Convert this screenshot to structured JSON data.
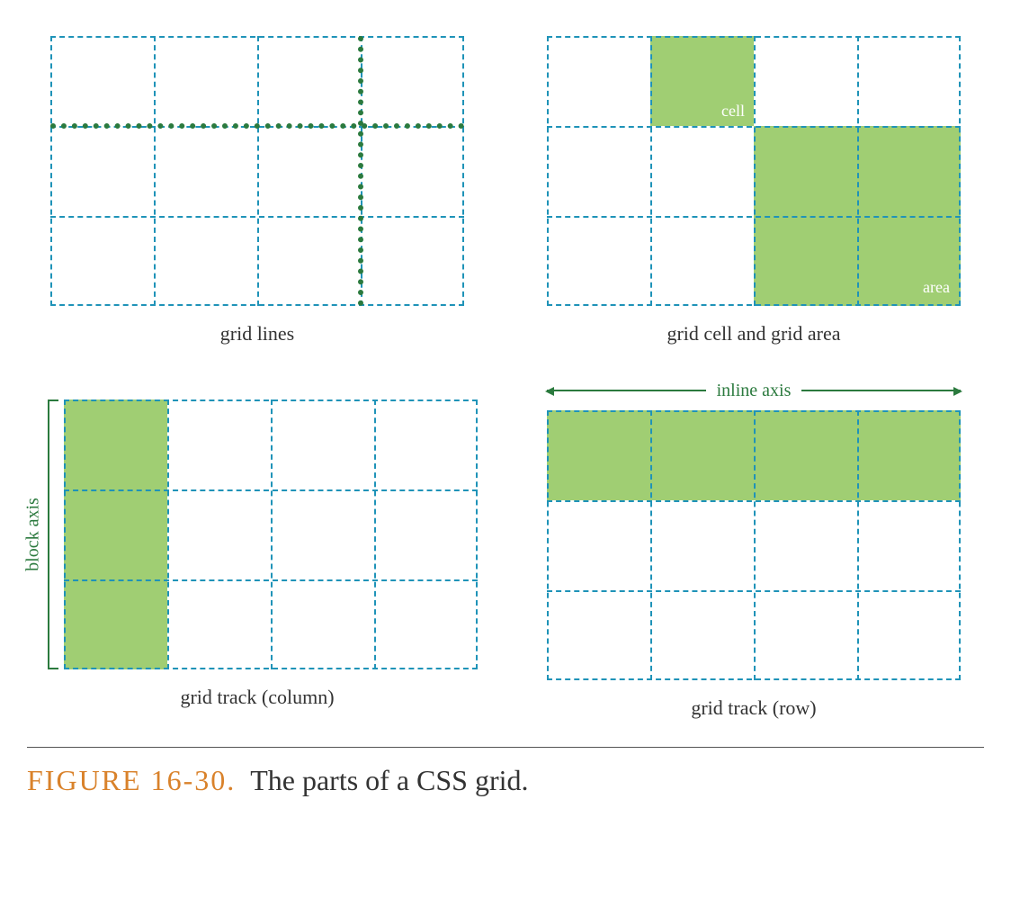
{
  "panels": {
    "a": {
      "caption": "grid lines"
    },
    "b": {
      "caption": "grid cell and grid area",
      "cell_label": "cell",
      "area_label": "area"
    },
    "c": {
      "caption": "grid track (column)",
      "axis_label": "block axis"
    },
    "d": {
      "caption": "grid track (row)",
      "axis_label": "inline axis"
    }
  },
  "figure": {
    "number": "FIGURE 16-30.",
    "title": "The parts of a CSS grid."
  }
}
